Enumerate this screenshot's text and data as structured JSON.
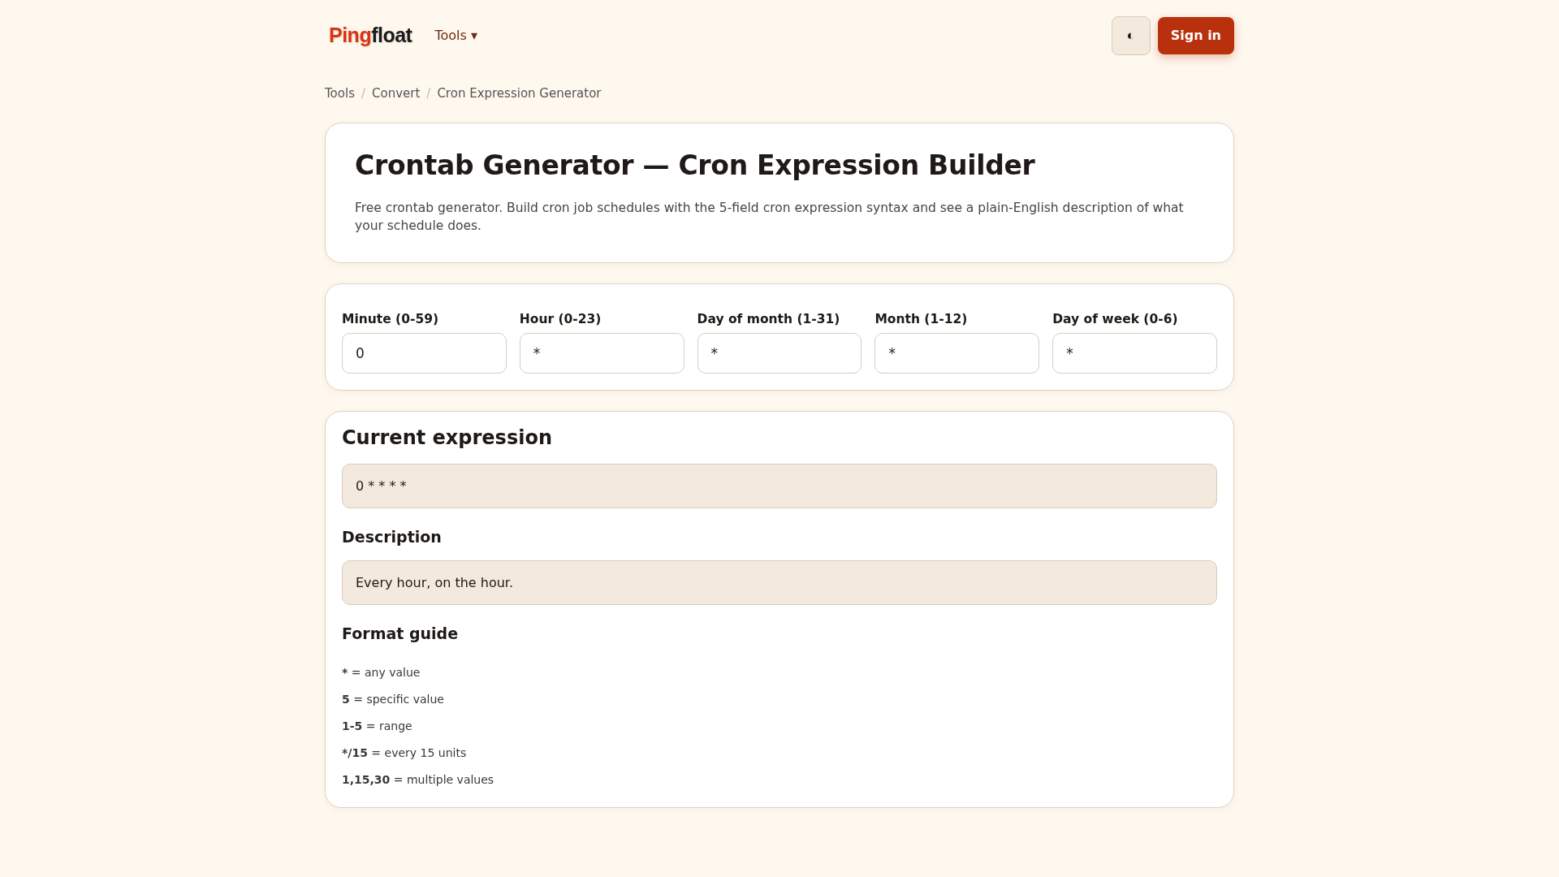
{
  "header": {
    "logo": [
      "Ping",
      "float"
    ],
    "nav": [
      {
        "label": "Tools ▾"
      }
    ],
    "theme_toggle": "◐",
    "sign_in": "Sign in"
  },
  "breadcrumbs": [
    {
      "label": "Tools"
    },
    {
      "label": "Convert"
    },
    {
      "label": "Cron Expression Generator"
    }
  ],
  "breadcrumb_separator": "/",
  "intro": {
    "title": "Crontab Generator — Cron Expression Builder",
    "description": "Free crontab generator. Build cron job schedules with the 5-field cron expression syntax and see a plain-English description of what your schedule does."
  },
  "fields": [
    {
      "label": "Minute (0-59)",
      "value": "0"
    },
    {
      "label": "Hour (0-23)",
      "value": "*"
    },
    {
      "label": "Day of month (1-31)",
      "value": "*"
    },
    {
      "label": "Month (1-12)",
      "value": "*"
    },
    {
      "label": "Day of week (0-6)",
      "value": "*"
    }
  ],
  "result": {
    "expression_heading": "Current expression",
    "expression": "0 * * * *",
    "description_heading": "Description",
    "description": "Every hour, on the hour.",
    "guide_heading": "Format guide",
    "guide": [
      {
        "term": "*",
        "meaning": " = any value"
      },
      {
        "term": "5",
        "meaning": " = specific value"
      },
      {
        "term": "1-5",
        "meaning": " = range"
      },
      {
        "term": "*/15",
        "meaning": " = every 15 units"
      },
      {
        "term": "1,15,30",
        "meaning": " = multiple values"
      }
    ]
  }
}
